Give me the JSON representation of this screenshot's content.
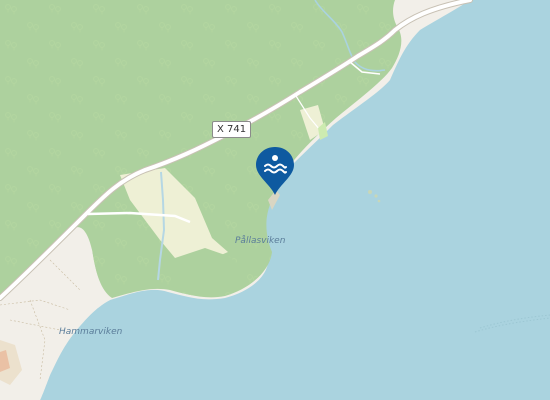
{
  "map": {
    "road_shield": "X 741",
    "places": {
      "pallasviken": "Pållasviken",
      "hammarviken": "Hammarviken"
    },
    "marker": {
      "icon": "swimming-icon",
      "color": "#0e5aa0"
    },
    "colors": {
      "water": "#aad3df",
      "forest": "#add19e",
      "land": "#f2efe9",
      "grass": "#cdebb0",
      "farmland": "#eef0d5",
      "road": "#ffffff",
      "stream": "#b5d7e4"
    }
  }
}
